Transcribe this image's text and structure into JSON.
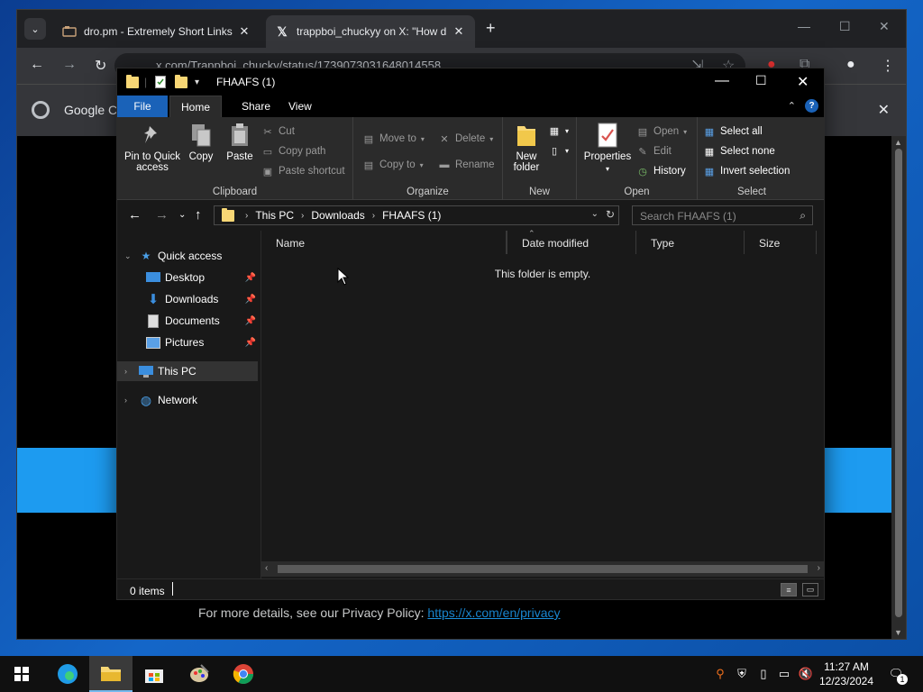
{
  "desktop": {
    "background": "#1466c8"
  },
  "browser": {
    "tabs": [
      {
        "title": "dro.pm - Extremely Short Links",
        "favicon": "link-favicon"
      },
      {
        "title": "trappboi_chuckyy on X: \"How d",
        "favicon": "x-favicon"
      }
    ],
    "url": "x.com/Trappboi_chucky/status/1739073031648014558",
    "infobar_text": "Google Ch",
    "privacy_text": "For more details, see our Privacy Policy:",
    "privacy_link": "https://x.com/en/privacy",
    "accent": "#1d9bf0"
  },
  "explorer": {
    "title": "FHAAFS (1)",
    "ribbon_tabs": {
      "file": "File",
      "home": "Home",
      "share": "Share",
      "view": "View"
    },
    "clipboard": {
      "pin": "Pin to Quick access",
      "copy": "Copy",
      "paste": "Paste",
      "cut": "Cut",
      "copy_path": "Copy path",
      "paste_shortcut": "Paste shortcut",
      "label": "Clipboard"
    },
    "organize": {
      "move_to": "Move to",
      "copy_to": "Copy to",
      "delete": "Delete",
      "rename": "Rename",
      "label": "Organize"
    },
    "new": {
      "new_folder": "New folder",
      "label": "New"
    },
    "open": {
      "properties": "Properties",
      "open": "Open",
      "edit": "Edit",
      "history": "History",
      "label": "Open"
    },
    "select": {
      "select_all": "Select all",
      "select_none": "Select none",
      "invert": "Invert selection",
      "label": "Select"
    },
    "breadcrumb": [
      "This PC",
      "Downloads",
      "FHAAFS (1)"
    ],
    "search_placeholder": "Search FHAAFS (1)",
    "nav": {
      "quick_access": "Quick access",
      "desktop": "Desktop",
      "downloads": "Downloads",
      "documents": "Documents",
      "pictures": "Pictures",
      "this_pc": "This PC",
      "network": "Network"
    },
    "columns": {
      "name": "Name",
      "date": "Date modified",
      "type": "Type",
      "size": "Size"
    },
    "empty_text": "This folder is empty.",
    "status_items": "0 items"
  },
  "taskbar": {
    "time": "11:27 AM",
    "date": "12/23/2024",
    "notification_count": "1"
  }
}
